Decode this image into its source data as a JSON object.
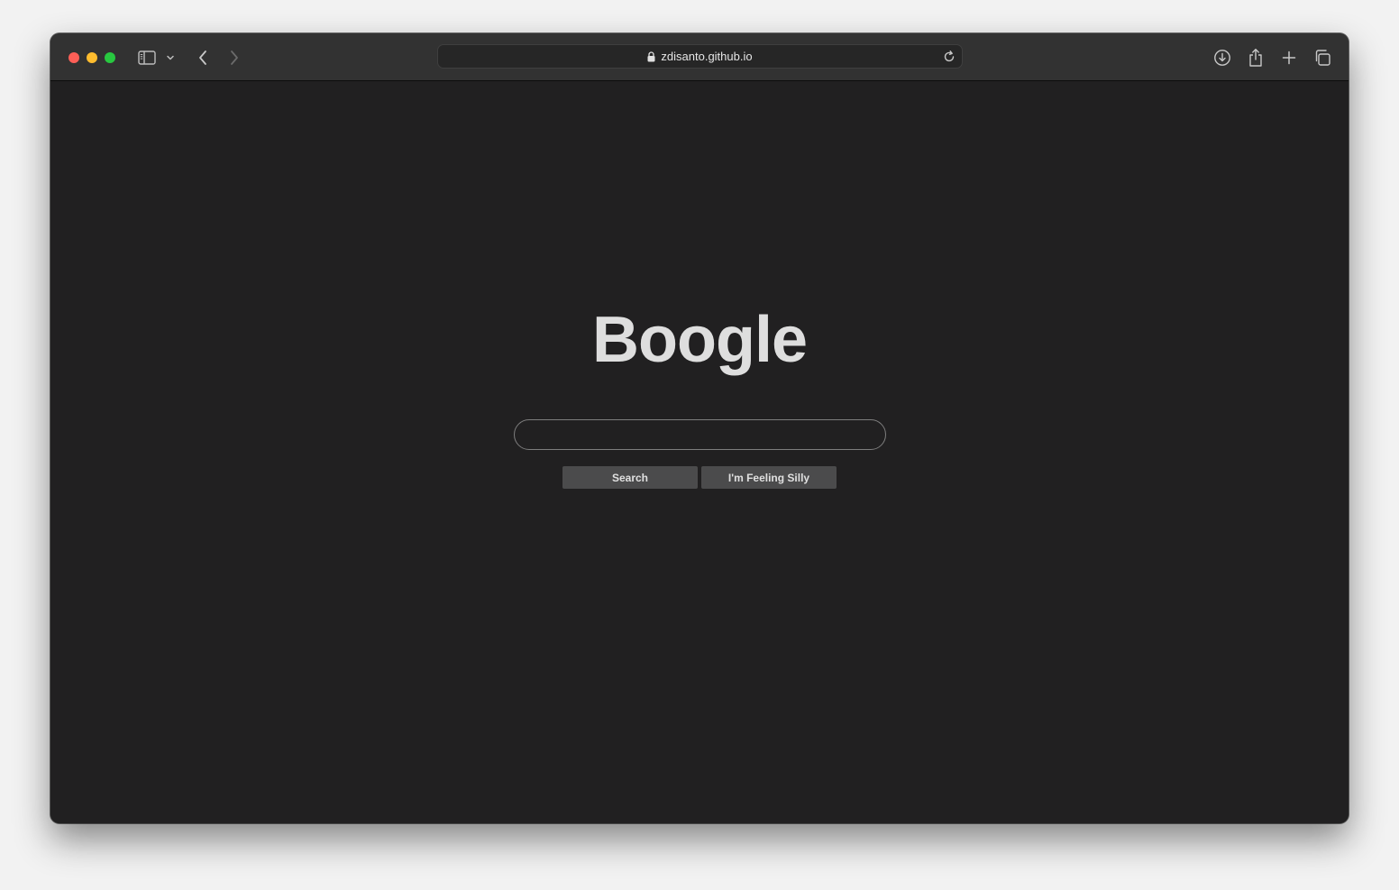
{
  "browser": {
    "url": "zdisanto.github.io",
    "icons": {
      "sidebar": "sidebar-icon",
      "sidebar_menu": "chevron-down-icon",
      "back": "chevron-left-icon",
      "forward": "chevron-right-icon",
      "lock": "lock-icon",
      "reload": "reload-icon",
      "downloads": "download-icon",
      "share": "share-icon",
      "new_tab": "plus-icon",
      "tab_overview": "tabs-icon"
    }
  },
  "page": {
    "logo": "Boogle",
    "search_placeholder": "",
    "search_value": "",
    "search_button": "Search",
    "silly_button": "I'm Feeling Silly"
  },
  "colors": {
    "background": "#212021",
    "toolbar": "#323232",
    "logo": "#dedede",
    "button": "#4b4b4c"
  }
}
